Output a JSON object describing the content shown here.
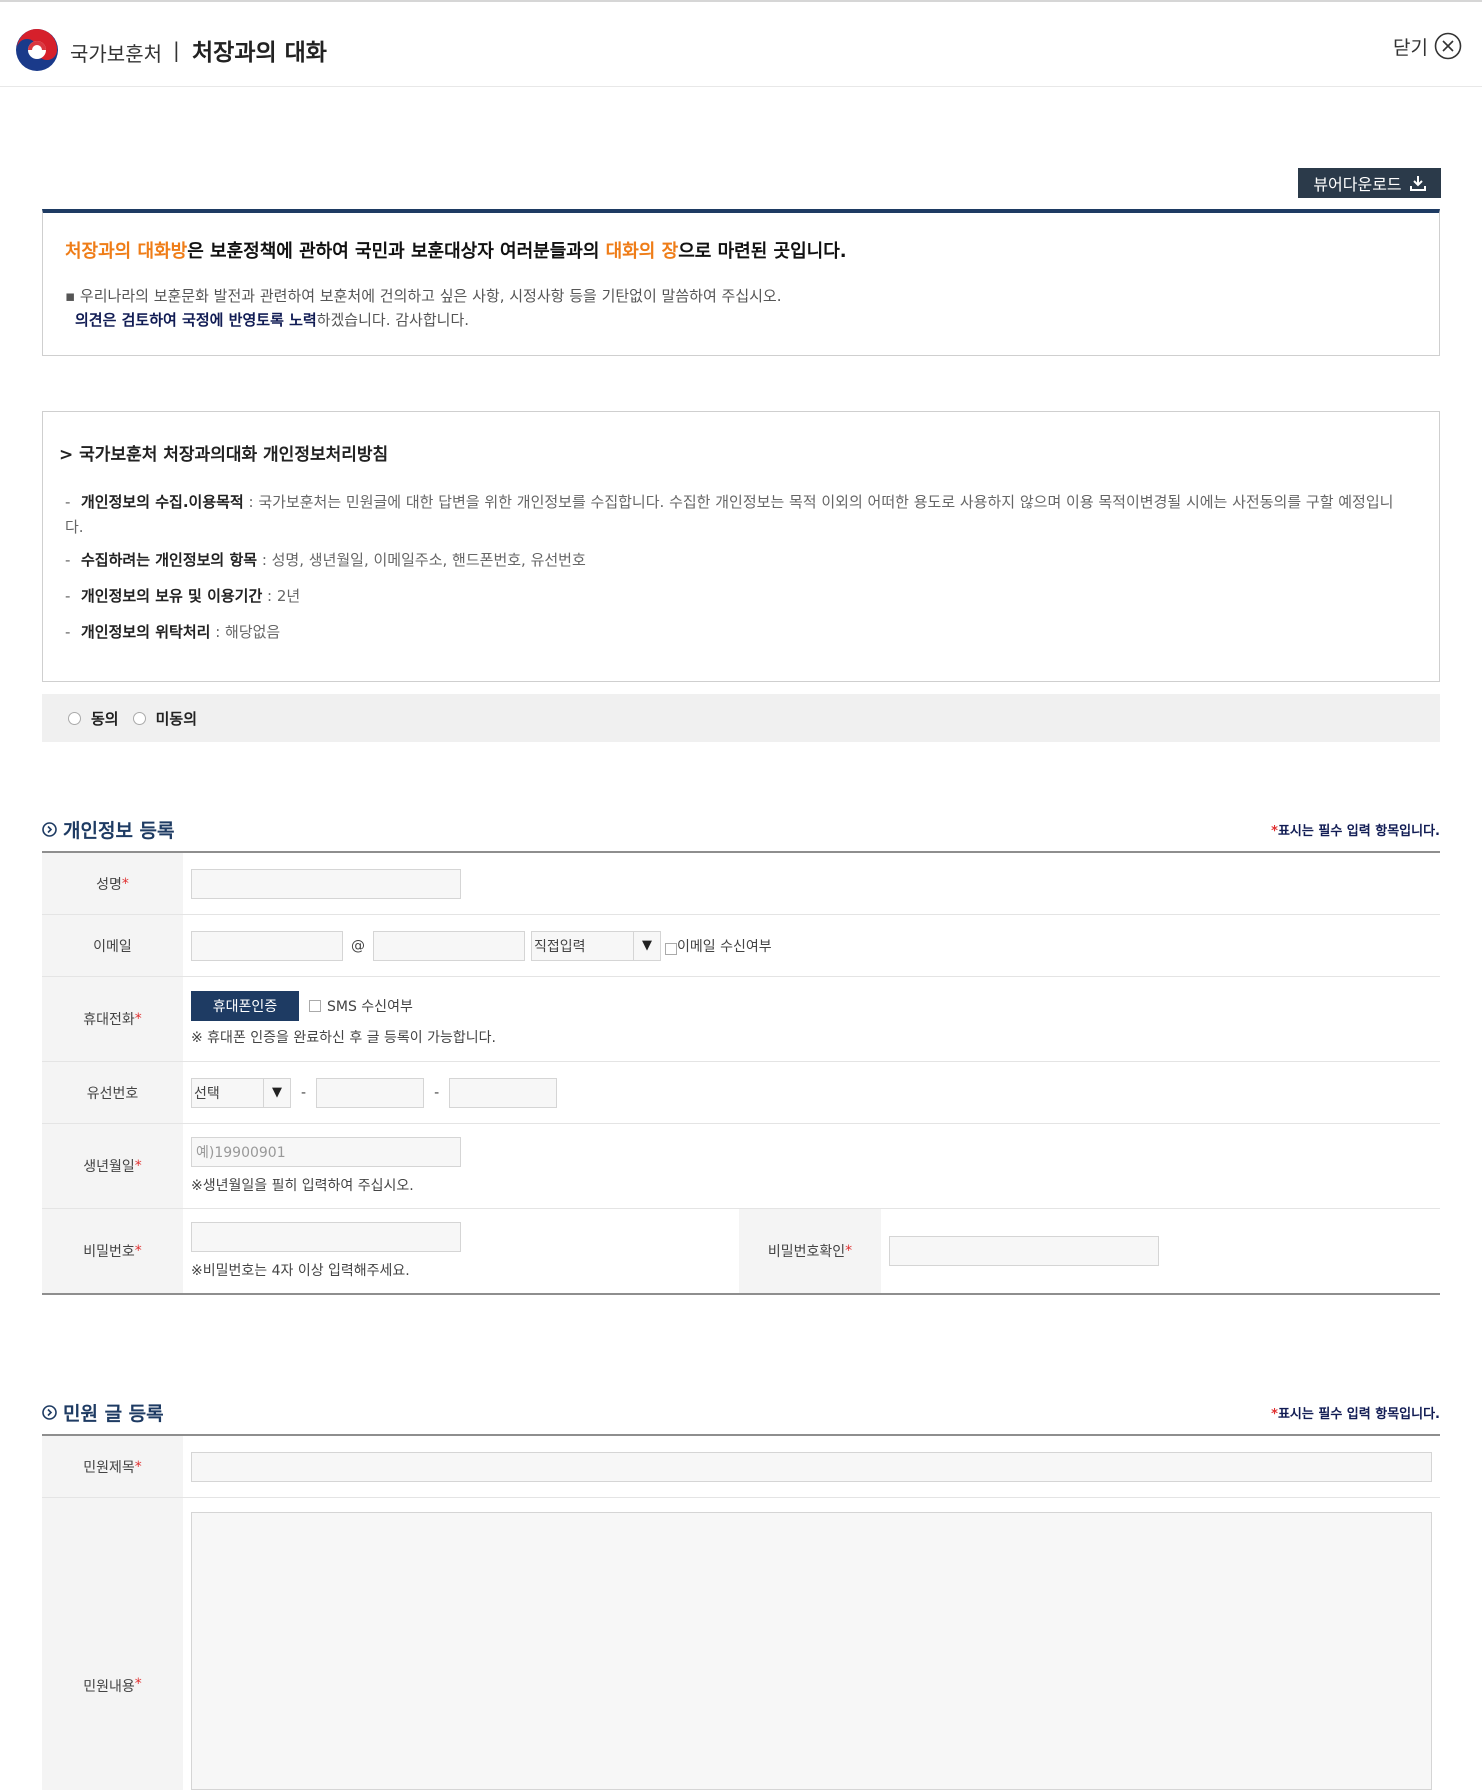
{
  "header": {
    "org": "국가보훈처",
    "separator": "|",
    "title": "처장과의 대화",
    "close_label": "닫기"
  },
  "viewer_download": "뷰어다운로드",
  "intro": {
    "head_hl1": "처장과의 대화방",
    "head_mid": "은 보훈정책에 관하여 국민과 보훈대상자 여러분들과의 ",
    "head_hl2": "대화의 장",
    "head_end": "으로 마련된 곳입니다.",
    "line1": "▪ 우리나라의 보훈문화 발전과 관련하여 보훈처에 건의하고 싶은 사항, 시정사항 등을 기탄없이 말씀하여 주십시오.",
    "line2_bold": "의견은 검토하여 국정에 반영토록 노력",
    "line2_rest": "하겠습니다. 감사합니다."
  },
  "policy": {
    "title": "> 국가보훈처 처장과의대화 개인정보처리방침",
    "items": [
      {
        "dash": "-",
        "label": "개인정보의 수집.이용목적",
        "text": " : 국가보훈처는 민원글에 대한 답변을 위한 개인정보를 수집합니다. 수집한 개인정보는 목적 이외의 어떠한 용도로 사용하지 않으며 이용 목적이변경될 시에는 사전동의를 구할 예정입니다."
      },
      {
        "dash": "-",
        "label": "수집하려는 개인정보의 항목",
        "text": " : 성명, 생년월일, 이메일주소, 핸드폰번호, 유선번호"
      },
      {
        "dash": "-",
        "label": "개인정보의 보유 및 이용기간",
        "text": " : 2년"
      },
      {
        "dash": "-",
        "label": "개인정보의 위탁처리",
        "text": " : 해당없음"
      }
    ]
  },
  "consent": {
    "agree": "동의",
    "disagree": "미동의"
  },
  "personal": {
    "section_title": "개인정보 등록",
    "required_star": "*",
    "required_note": "표시는 필수 입력 항목입니다.",
    "name_label": "성명",
    "email_label": "이메일",
    "email_at": "@",
    "email_domain_select": "직접입력",
    "email_receive": "이메일 수신여부",
    "mobile_label": "휴대전화",
    "mobile_button": "휴대폰인증",
    "sms_receive": "SMS 수신여부",
    "mobile_note": "※ 휴대폰 인증을 완료하신 후 글 등록이 가능합니다.",
    "landline_label": "유선번호",
    "landline_select": "선택",
    "dash": "-",
    "birth_label": "생년월일",
    "birth_placeholder": "예)19900901",
    "birth_note": "※생년월일을 필히 입력하여 주십시오.",
    "password_label": "비밀번호",
    "password_note": "※비밀번호는 4자 이상 입력해주세요.",
    "password_confirm_label": "비밀번호확인"
  },
  "petition": {
    "section_title": "민원 글 등록",
    "required_star": "*",
    "required_note": "표시는 필수 입력 항목입니다.",
    "subject_label": "민원제목",
    "content_label": "민원내용"
  },
  "arrow_glyph": "▼",
  "colors": {
    "navy": "#1e3b63",
    "orange": "#ef7d18",
    "required": "#e03030"
  }
}
